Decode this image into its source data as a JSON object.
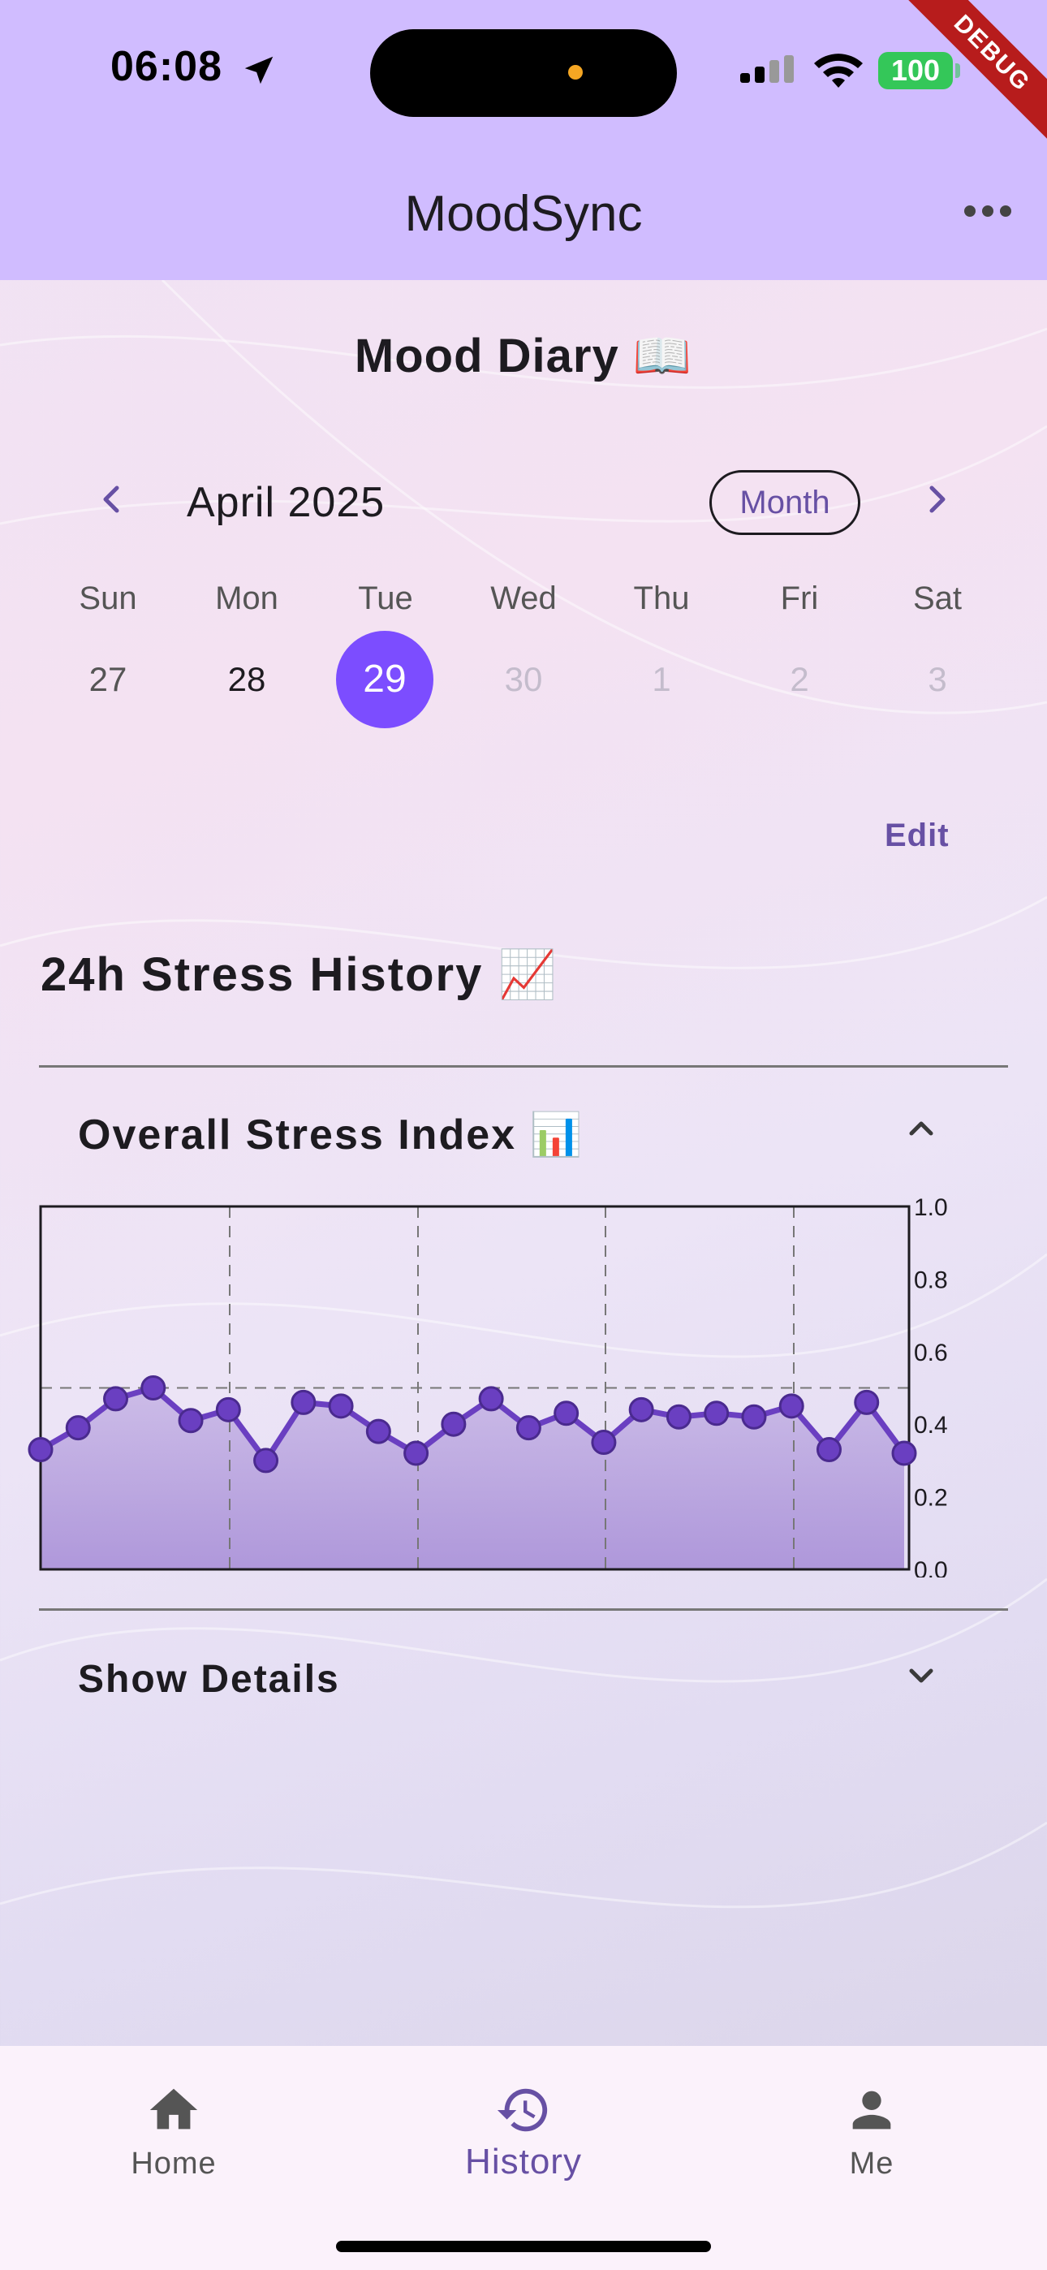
{
  "status_bar": {
    "time": "06:08",
    "battery": "100"
  },
  "debug_banner": "DEBUG",
  "app_bar": {
    "title": "MoodSync"
  },
  "diary": {
    "title": "Mood Diary 📖",
    "month_label": "April 2025",
    "view_toggle": "Month",
    "weekdays": [
      "Sun",
      "Mon",
      "Tue",
      "Wed",
      "Thu",
      "Fri",
      "Sat"
    ],
    "days": [
      "27",
      "28",
      "29",
      "30",
      "1",
      "2",
      "3"
    ],
    "selected_day": "29",
    "edit_label": "Edit"
  },
  "stress": {
    "title": "24h Stress History 📈",
    "overall_title": "Overall Stress Index 📊",
    "details_label": "Show Details"
  },
  "chart_data": {
    "type": "area",
    "title": "",
    "xlabel": "",
    "ylabel": "",
    "ylim": [
      0.0,
      1.0
    ],
    "y_ticks": [
      "0.0",
      "0.2",
      "0.4",
      "0.6",
      "0.8",
      "1.0"
    ],
    "grid": true,
    "colors": {
      "line": "#6a3fc1",
      "fill": "#a58bd6"
    },
    "series": [
      {
        "values": [
          0.33,
          0.39,
          0.47,
          0.5,
          0.41,
          0.44,
          0.3,
          0.46,
          0.45,
          0.38,
          0.32,
          0.4,
          0.47,
          0.39,
          0.43,
          0.35,
          0.44,
          0.42,
          0.43,
          0.42,
          0.45,
          0.33,
          0.46,
          0.32
        ]
      }
    ]
  },
  "bottom_nav": {
    "items": [
      {
        "label": "Home",
        "icon": "home-icon"
      },
      {
        "label": "History",
        "icon": "history-icon"
      },
      {
        "label": "Me",
        "icon": "person-icon"
      }
    ],
    "active": "History"
  }
}
